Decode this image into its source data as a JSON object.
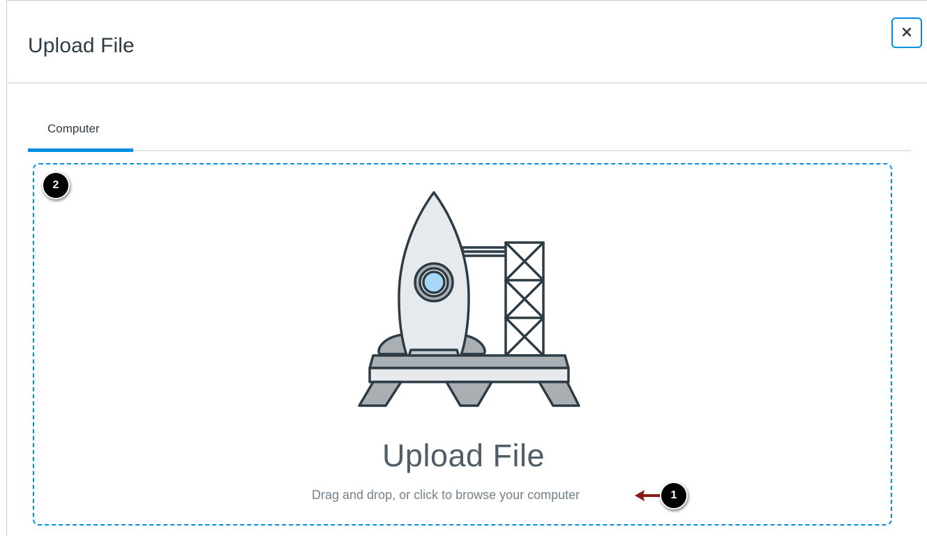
{
  "modal": {
    "title": "Upload File",
    "close_label": "×"
  },
  "tabs": [
    {
      "label": "Computer",
      "active": true
    }
  ],
  "dropzone": {
    "title": "Upload File",
    "subtitle": "Drag and drop, or click to browse your computer",
    "illustration": "rocket-launch-pad"
  },
  "callouts": [
    {
      "number": "1"
    },
    {
      "number": "2"
    }
  ],
  "colors": {
    "accent": "#008ee2",
    "arrow": "#8b1a1a",
    "text": "#2d3b45",
    "muted": "#73818c"
  }
}
